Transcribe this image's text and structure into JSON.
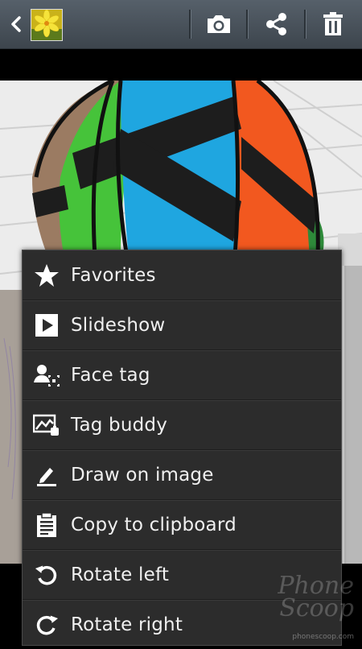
{
  "header": {
    "back_icon": "chevron-left-icon",
    "thumbnail": "yellow-flower-thumbnail",
    "actions": [
      {
        "name": "camera-button",
        "icon": "camera-icon"
      },
      {
        "name": "share-button",
        "icon": "share-icon"
      },
      {
        "name": "delete-button",
        "icon": "trash-icon"
      }
    ]
  },
  "menu": {
    "items": [
      {
        "label": "Favorites",
        "icon": "star-icon"
      },
      {
        "label": "Slideshow",
        "icon": "play-icon"
      },
      {
        "label": "Face tag",
        "icon": "face-tag-icon"
      },
      {
        "label": "Tag buddy",
        "icon": "tag-buddy-icon"
      },
      {
        "label": "Draw on image",
        "icon": "pencil-icon"
      },
      {
        "label": "Copy to clipboard",
        "icon": "clipboard-icon"
      },
      {
        "label": "Rotate left",
        "icon": "rotate-left-icon"
      },
      {
        "label": "Rotate right",
        "icon": "rotate-right-icon"
      }
    ]
  },
  "watermark": {
    "line1": "Phone",
    "line2": "Scoop",
    "url": "phonescoop.com"
  },
  "colors": {
    "toolbar": "#4a535c",
    "menu_bg": "#2c2c2c",
    "menu_text": "#f0f0f0"
  }
}
